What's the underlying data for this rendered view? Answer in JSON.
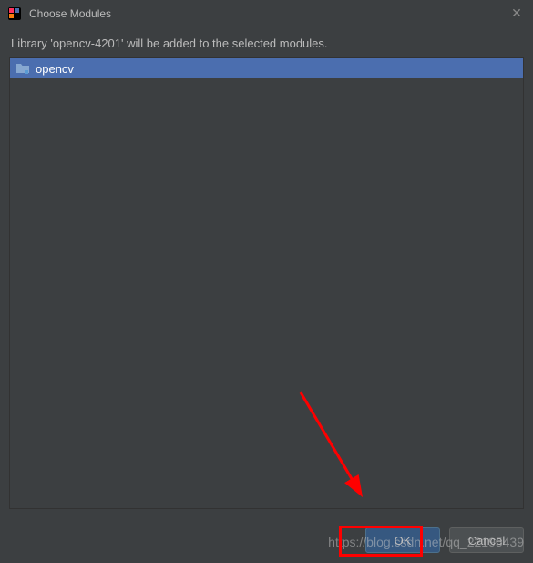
{
  "window": {
    "title": "Choose Modules"
  },
  "description": "Library 'opencv-4201' will be added to the selected modules.",
  "modules": {
    "items": [
      {
        "label": "opencv"
      }
    ]
  },
  "buttons": {
    "ok": "OK",
    "cancel": "Cancel"
  },
  "watermark": "https://blog.csdn.net/qq_22195439"
}
